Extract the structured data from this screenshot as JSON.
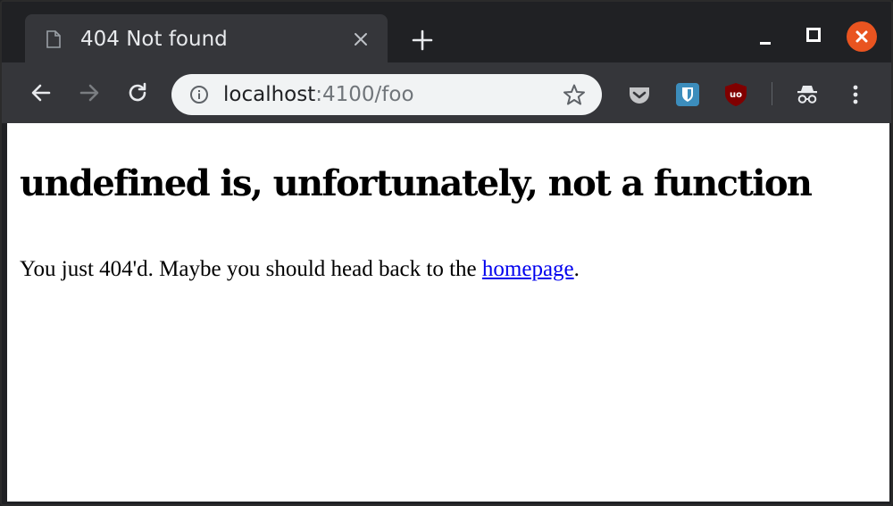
{
  "browser": {
    "tab": {
      "title": "404 Not found"
    },
    "address_bar": {
      "host": "localhost",
      "rest": ":4100/foo"
    }
  },
  "page": {
    "heading": "undefined is, unfortunately, not a function",
    "message_before": "You just 404'd. Maybe you should head back to the ",
    "link_text": "homepage",
    "message_after": "."
  },
  "colors": {
    "frame": "#202124",
    "toolbar": "#35363a",
    "omnibox": "#f1f3f4",
    "close_button": "#e95420",
    "link": "#0000ee"
  },
  "icons": [
    "file-icon",
    "close-icon",
    "plus-icon",
    "minimize-icon",
    "maximize-icon",
    "back-arrow-icon",
    "forward-arrow-icon",
    "reload-icon",
    "info-icon",
    "star-icon",
    "pocket-icon",
    "bitwarden-icon",
    "ublock-icon",
    "incognito-icon",
    "menu-dots-icon"
  ]
}
